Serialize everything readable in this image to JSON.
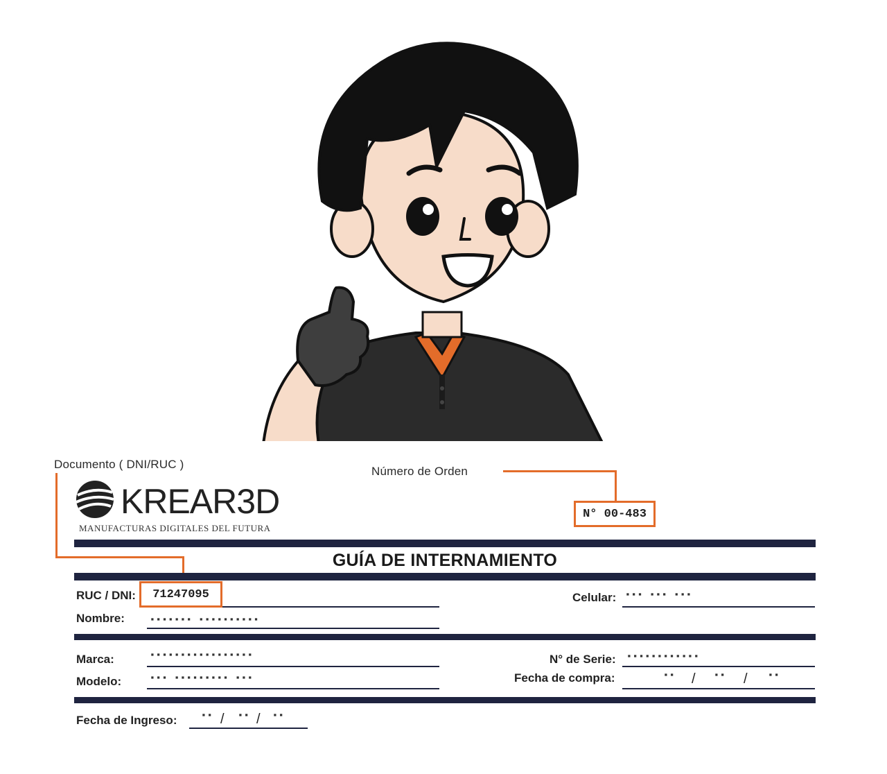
{
  "mascot": {
    "description_icon": "thumbs-up-technician-icon"
  },
  "header": {
    "doc_label": "Documento ( DNI/RUC )",
    "order_label": "Número de Orden",
    "order_number": "N° 00-483",
    "logo_text": "KREAR3D",
    "logo_tagline": "MANUFACTURAS DIGITALES DEL FUTURA"
  },
  "title": "GUÍA DE INTERNAMIENTO",
  "customer": {
    "ruc_label": "RUC / DNI:",
    "ruc_value": "71247095",
    "name_label": "Nombre:",
    "name_value": "▪▪▪▪▪▪▪ ▪▪▪▪▪▪▪▪▪▪",
    "phone_label": "Celular:",
    "phone_value": "▪▪▪ ▪▪▪ ▪▪▪"
  },
  "device": {
    "brand_label": "Marca:",
    "brand_value": "▪▪▪▪▪▪▪▪▪▪▪▪▪▪▪▪▪",
    "model_label": "Modelo:",
    "model_value": "▪▪▪ ▪▪▪▪▪▪▪▪▪ ▪▪▪",
    "serial_label": "N° de Serie:",
    "serial_value": "▪▪▪▪▪▪▪▪▪▪▪▪",
    "purchase_label": "Fecha de compra:",
    "purchase_d": "▪▪",
    "purchase_m": "▪▪",
    "purchase_y": "▪▪"
  },
  "entry": {
    "date_label": "Fecha de Ingreso:",
    "d": "▪▪",
    "m": "▪▪",
    "y": "▪▪",
    "sep": "/"
  },
  "colors": {
    "accent": "#e36c2a",
    "band": "#1f2440",
    "shirt": "#2b2b2b",
    "hair": "#111111"
  }
}
